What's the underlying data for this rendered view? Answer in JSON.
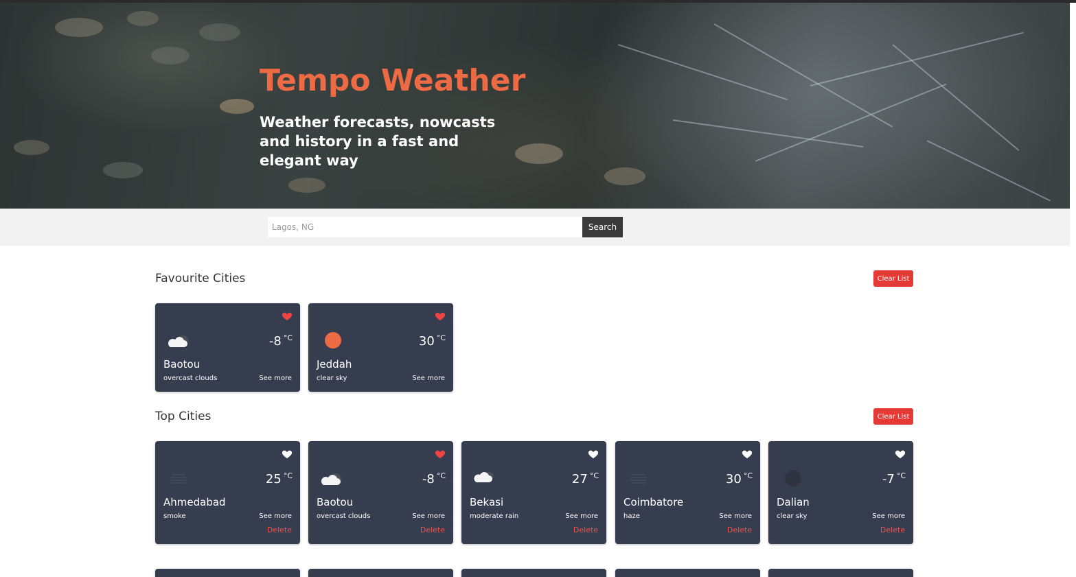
{
  "hero": {
    "title": "Tempo Weather",
    "subtitle": "Weather forecasts, nowcasts and history in a fast and elegant way"
  },
  "search": {
    "placeholder": "Lagos, NG",
    "button_label": "Search"
  },
  "favourites": {
    "title": "Favourite Cities",
    "clear_label": "Clear List",
    "cards": [
      {
        "city": "Baotou",
        "condition": "overcast clouds",
        "temp": "-8",
        "unit": "°C",
        "see_more": "See more",
        "favourite": true,
        "icon": "overcast-clouds-icon"
      },
      {
        "city": "Jeddah",
        "condition": "clear sky",
        "temp": "30",
        "unit": "°C",
        "see_more": "See more",
        "favourite": true,
        "icon": "sun-icon"
      }
    ]
  },
  "top": {
    "title": "Top Cities",
    "clear_label": "Clear List",
    "delete_label": "Delete",
    "cards": [
      {
        "city": "Ahmedabad",
        "condition": "smoke",
        "temp": "25",
        "unit": "°C",
        "see_more": "See more",
        "favourite": false,
        "icon": "smoke-icon"
      },
      {
        "city": "Baotou",
        "condition": "overcast clouds",
        "temp": "-8",
        "unit": "°C",
        "see_more": "See more",
        "favourite": true,
        "icon": "overcast-clouds-icon"
      },
      {
        "city": "Bekasi",
        "condition": "moderate rain",
        "temp": "27",
        "unit": "°C",
        "see_more": "See more",
        "favourite": false,
        "icon": "rain-icon"
      },
      {
        "city": "Coimbatore",
        "condition": "haze",
        "temp": "30",
        "unit": "°C",
        "see_more": "See more",
        "favourite": false,
        "icon": "haze-icon"
      },
      {
        "city": "Dalian",
        "condition": "clear sky",
        "temp": "-7",
        "unit": "°C",
        "see_more": "See more",
        "favourite": false,
        "icon": "clear-night-icon"
      }
    ]
  },
  "colors": {
    "accent": "#ec6a44",
    "card_bg": "#353d4f",
    "danger": "#e53935",
    "heart_active": "#ef4444",
    "heart_inactive": "#ffffff"
  }
}
